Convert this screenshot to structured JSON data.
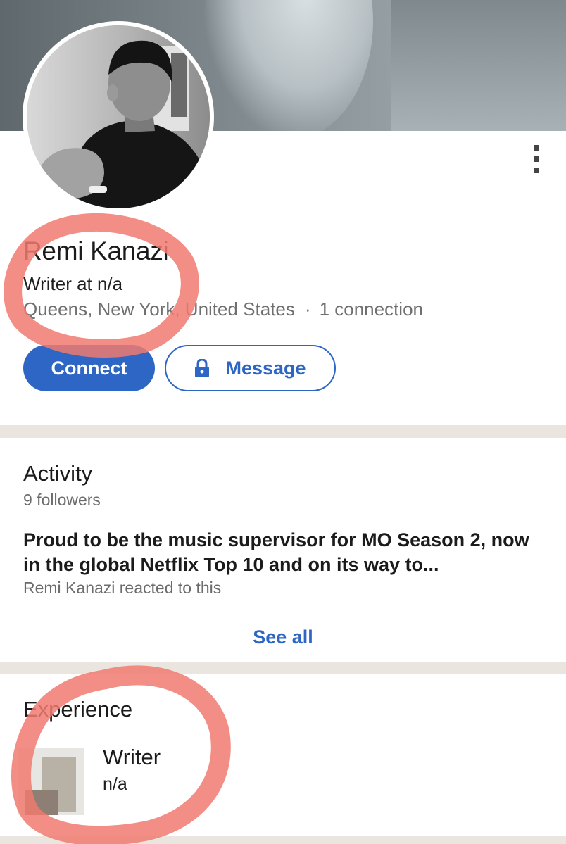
{
  "profile": {
    "name": "Remi Kanazi",
    "headline": "Writer at n/a",
    "location": "Queens, New York, United States",
    "separator": "·",
    "connections": "1 connection",
    "more_icon": "more-vertical-icon"
  },
  "actions": {
    "connect_label": "Connect",
    "message_label": "Message",
    "message_icon": "lock-icon"
  },
  "activity": {
    "title": "Activity",
    "followers": "9 followers",
    "post_text": "Proud to be the music supervisor for MO Season 2, now in the global Netflix Top 10 and on its way to...",
    "post_sub": "Remi Kanazi reacted to this",
    "see_all_label": "See all"
  },
  "experience": {
    "title": "Experience",
    "items": [
      {
        "role": "Writer",
        "company": "n/a"
      }
    ]
  },
  "colors": {
    "accent": "#2d66c4",
    "divider": "#eae6df",
    "annotation": "#f07a70"
  }
}
